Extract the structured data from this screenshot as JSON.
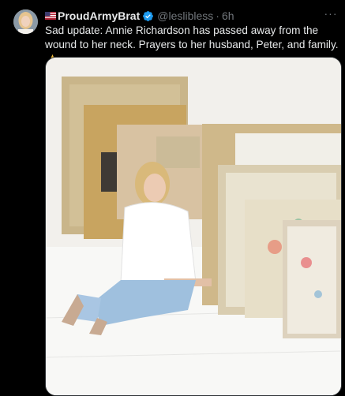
{
  "tweet": {
    "display_name": "ProudArmyBrat",
    "handle": "@leslibless",
    "separator": "·",
    "time": "6h",
    "text": "Sad update:  Annie Richardson has passed away from the wound to her neck. Prayers to her husband, Peter, and family.",
    "more_label": "···"
  },
  "icons": {
    "flag": "us-flag-icon",
    "verified": "verified-badge-icon",
    "emoji": "folded-hands-emoji-icon"
  },
  "colors": {
    "background": "#000000",
    "text_primary": "#e7e9ea",
    "text_secondary": "#71767b",
    "verified_blue": "#1d9bf0",
    "border": "#2f3336"
  }
}
